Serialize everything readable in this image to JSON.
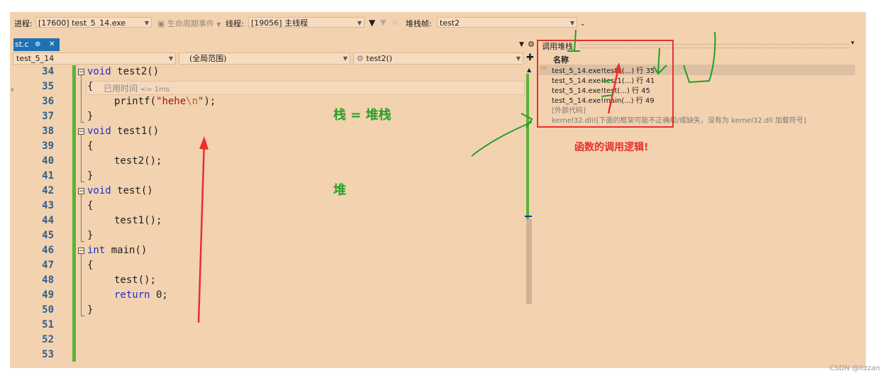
{
  "toolbar": {
    "process_label": "进程:",
    "process_value": "[17600] test_5_14.exe",
    "lifecycle_label": "生命周期事件",
    "thread_label": "线程:",
    "thread_value": "[19056] 主线程",
    "stackframe_label": "堆栈帧:",
    "stackframe_value": "test2"
  },
  "tab": {
    "label": "st.c",
    "pin": "⊕",
    "close": "✕"
  },
  "nav": {
    "project": "test_5_14",
    "scope": "(全局范围)",
    "function": "test2()"
  },
  "editor": {
    "perf_hint": "已用时间",
    "perf_value": "<= 1ms",
    "lines": [
      {
        "n": "34"
      },
      {
        "n": "35"
      },
      {
        "n": "36"
      },
      {
        "n": "37"
      },
      {
        "n": "38"
      },
      {
        "n": "39"
      },
      {
        "n": "40"
      },
      {
        "n": "41"
      },
      {
        "n": "42"
      },
      {
        "n": "43"
      },
      {
        "n": "44"
      },
      {
        "n": "45"
      },
      {
        "n": "46"
      },
      {
        "n": "47"
      },
      {
        "n": "48"
      },
      {
        "n": "49"
      },
      {
        "n": "50"
      },
      {
        "n": "51"
      },
      {
        "n": "52"
      },
      {
        "n": "53"
      }
    ],
    "code": {
      "l34_kw": "void",
      "l34_rest": " test2()",
      "l35": "{",
      "l36_fn": "printf(",
      "l36_str1": "\"hehe",
      "l36_esc": "\\n",
      "l36_str2": "\"",
      "l36_end": ");",
      "l37": "}",
      "l38_kw": "void",
      "l38_rest": " test1()",
      "l39": "{",
      "l40": "test2();",
      "l41": "}",
      "l42_kw": "void",
      "l42_rest": " test()",
      "l43": "{",
      "l44": "test1();",
      "l45": "}",
      "l46_kw": "int",
      "l46_rest": " main()",
      "l47": "{",
      "l48": "test();",
      "l49_kw": "return",
      "l49_rest": " 0;",
      "l50": "}"
    }
  },
  "callstack": {
    "title": "调用堆栈",
    "column_name": "名称",
    "rows": [
      {
        "text": "test_5_14.exe!test2(...) 行 35"
      },
      {
        "text": "test_5_14.exe!test1(...) 行 41"
      },
      {
        "text": "test_5_14.exe!test(...) 行 45"
      },
      {
        "text": "test_5_14.exe!main(...) 行 49"
      },
      {
        "text": "[外部代码]"
      },
      {
        "text": "kernel32.dll![下面的框架可能不正确和/或缺失，没有为 kernel32.dll 加载符号]"
      }
    ]
  },
  "annotations": {
    "stack_eq": "栈 = 堆栈",
    "heap": "堆",
    "call_logic": "函数的调用逻辑!"
  },
  "watermark": "CSDN @itzzan",
  "colors": {
    "accent_green": "#5bb338",
    "annotation_red": "#e8302c",
    "annotation_green": "#24a024",
    "tab_blue": "#1e72b4"
  }
}
